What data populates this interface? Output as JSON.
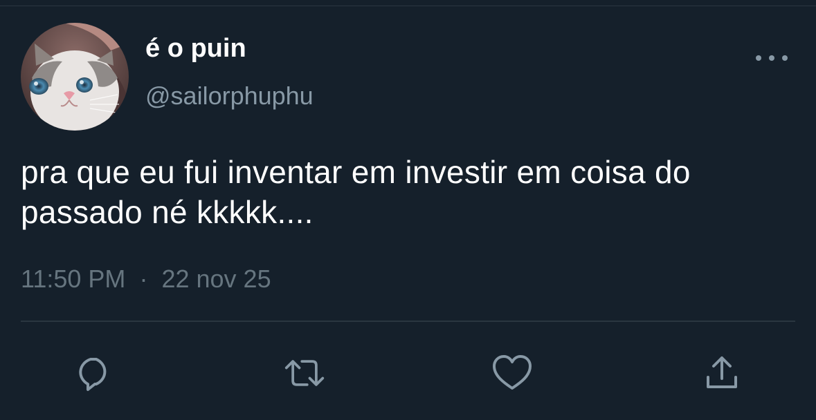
{
  "tweet": {
    "display_name": "é o puin",
    "handle": "@sailorphuphu",
    "text": "pra que eu fui inventar em investir em coisa do passado né kkkkk....",
    "timestamp": "11:50 PM",
    "separator": "·",
    "date": "22 nov 25",
    "avatar": "cat-avatar",
    "more_icon": "more-dots-icon"
  },
  "actions": [
    {
      "name": "reply",
      "icon": "reply-icon"
    },
    {
      "name": "retweet",
      "icon": "retweet-icon"
    },
    {
      "name": "like",
      "icon": "heart-icon"
    },
    {
      "name": "share",
      "icon": "share-icon"
    }
  ],
  "colors": {
    "background": "#15202b",
    "primary_text": "#ffffff",
    "secondary_text": "#8899a6",
    "meta_text": "#66757f",
    "divider": "#2a3640",
    "icon": "#8899a6"
  }
}
